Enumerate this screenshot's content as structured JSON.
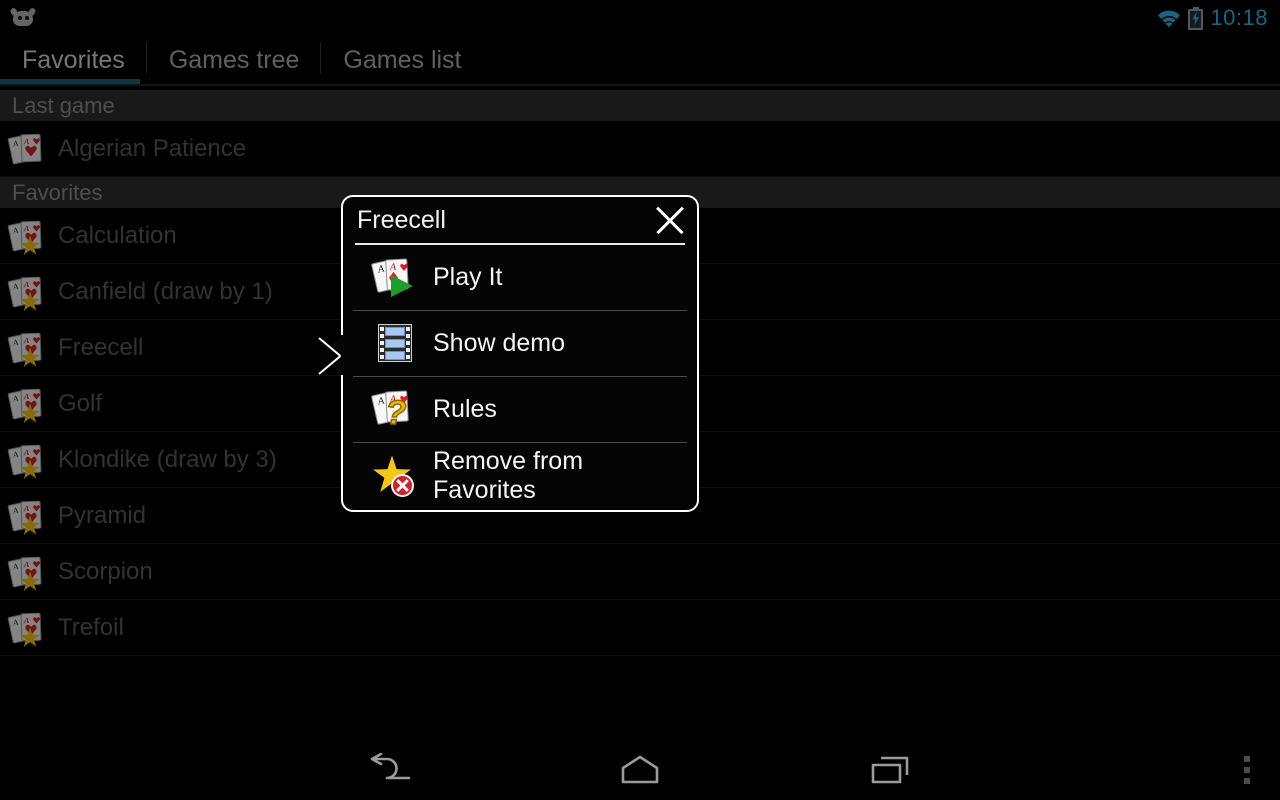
{
  "statusbar": {
    "notification_icon": "android-robot-icon",
    "wifi_icon": "wifi-icon",
    "battery_icon": "battery-charging-icon",
    "time": "10:18",
    "accent_color": "#33b5e5"
  },
  "tabs": [
    {
      "label": "Favorites",
      "selected": true
    },
    {
      "label": "Games tree",
      "selected": false
    },
    {
      "label": "Games list",
      "selected": false
    }
  ],
  "tab_indicator_color": "#1d6377",
  "list": {
    "sections": [
      {
        "header": "Last game",
        "items": [
          {
            "label": "Algerian Patience",
            "icon": "cards-icon",
            "favorite": false
          }
        ]
      },
      {
        "header": "Favorites",
        "items": [
          {
            "label": "Calculation",
            "icon": "cards-star-icon",
            "favorite": true
          },
          {
            "label": "Canfield (draw by 1)",
            "icon": "cards-star-icon",
            "favorite": true
          },
          {
            "label": "Freecell",
            "icon": "cards-star-icon",
            "favorite": true
          },
          {
            "label": "Golf",
            "icon": "cards-star-icon",
            "favorite": true
          },
          {
            "label": "Klondike (draw by 3)",
            "icon": "cards-star-icon",
            "favorite": true
          },
          {
            "label": "Pyramid",
            "icon": "cards-star-icon",
            "favorite": true
          },
          {
            "label": "Scorpion",
            "icon": "cards-star-icon",
            "favorite": true
          },
          {
            "label": "Trefoil",
            "icon": "cards-star-icon",
            "favorite": true
          }
        ]
      }
    ]
  },
  "dialog": {
    "title": "Freecell",
    "close_icon": "close-icon",
    "items": [
      {
        "label": "Play It",
        "icon": "cards-play-icon"
      },
      {
        "label": "Show demo",
        "icon": "film-strip-icon"
      },
      {
        "label": "Rules",
        "icon": "cards-question-icon"
      },
      {
        "label": "Remove from Favorites",
        "icon": "star-remove-icon"
      }
    ]
  },
  "navbar": {
    "back": "back-icon",
    "home": "home-icon",
    "recents": "recents-icon",
    "overflow": "overflow-menu-icon"
  }
}
